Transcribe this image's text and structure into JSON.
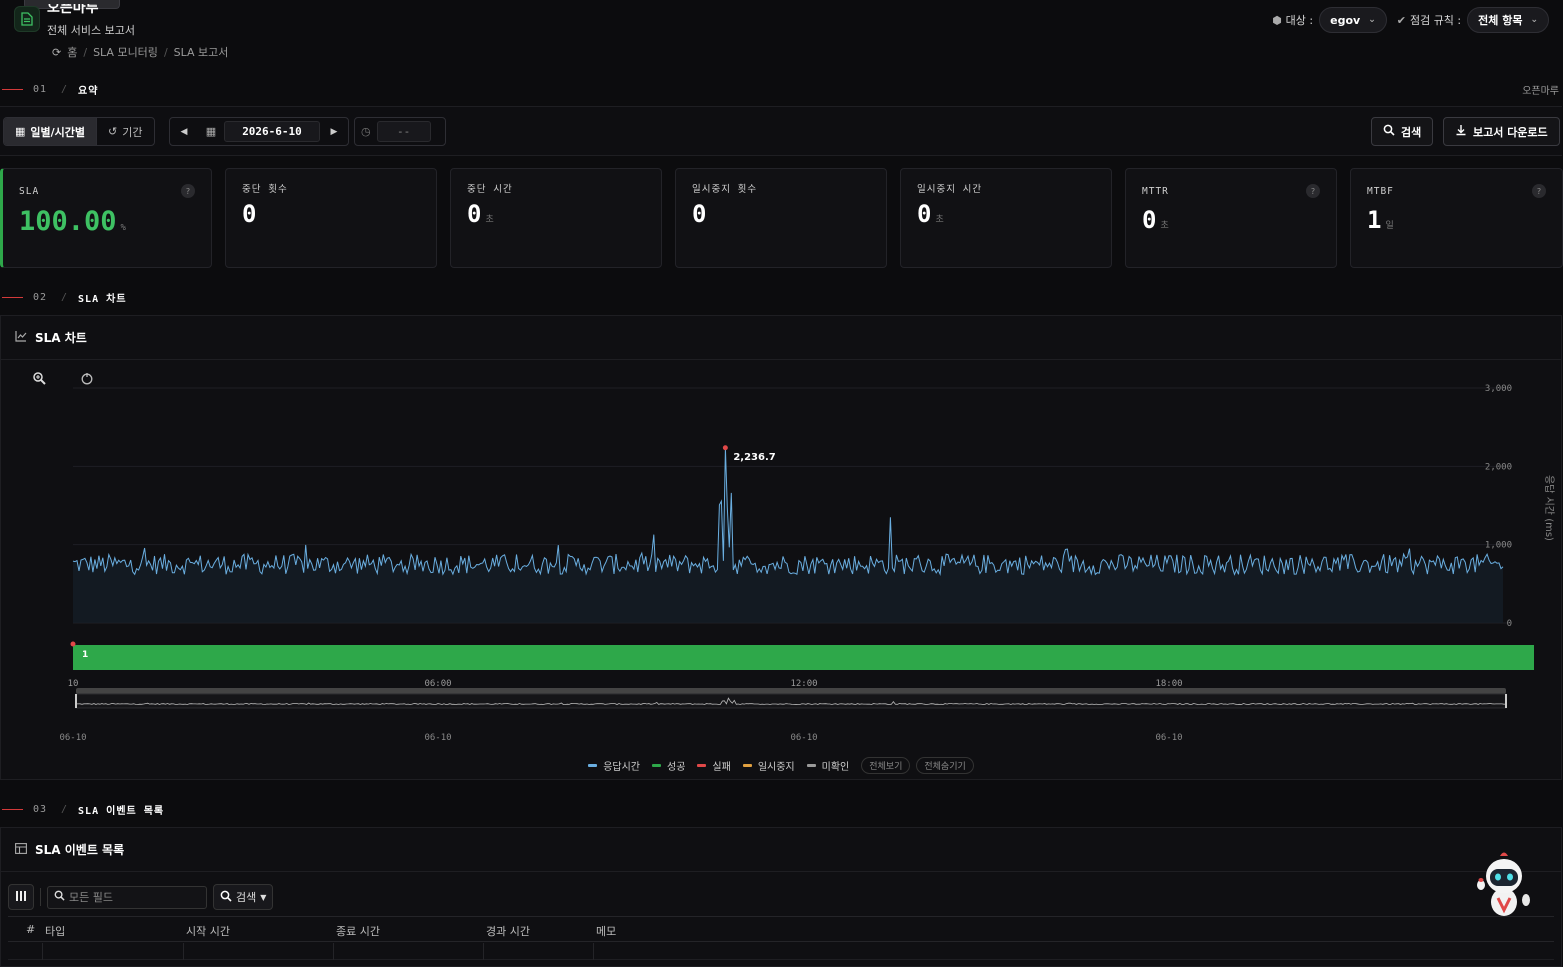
{
  "header": {
    "app_title": "오픈마루",
    "app_subtitle": "전체 서비스 보고서",
    "breadcrumb": [
      "홈",
      "SLA 모니터링",
      "SLA 보고서"
    ],
    "target_label": "대상 :",
    "target_value": "egov",
    "rule_label": "점검 규칙 :",
    "rule_value": "전체 항목"
  },
  "sections": {
    "s1": {
      "num": "01",
      "title": "요약",
      "right": "오픈마루"
    },
    "s2": {
      "num": "02",
      "title": "SLA 차트"
    },
    "s3": {
      "num": "03",
      "title": "SLA 이벤트 목록"
    }
  },
  "toolbar": {
    "mode_daily": "일별/시간별",
    "mode_period": "기간",
    "date": "2026-6-10",
    "time": "--",
    "search_button": "검색",
    "download_button": "보고서 다운로드"
  },
  "cards": [
    {
      "label": "SLA",
      "value": "100.00",
      "unit": "%",
      "help": "?"
    },
    {
      "label": "중단 횟수",
      "value": "0",
      "unit": ""
    },
    {
      "label": "중단 시간",
      "value": "0",
      "unit": "초"
    },
    {
      "label": "일시중지 횟수",
      "value": "0",
      "unit": ""
    },
    {
      "label": "일시중지 시간",
      "value": "0",
      "unit": "초"
    },
    {
      "label": "MTTR",
      "value": "0",
      "unit": "초",
      "help": "?"
    },
    {
      "label": "MTBF",
      "value": "1",
      "unit": "일",
      "help": "?"
    }
  ],
  "chart_panel": {
    "title": "SLA 차트",
    "peak_label": "2,236.7",
    "status_bar_label": "1",
    "legend": [
      "응답시간",
      "성공",
      "실패",
      "일시중지",
      "미확인"
    ],
    "legend_colors": [
      "#6aaee0",
      "#2ea84a",
      "#e04848",
      "#e0a040",
      "#9a9a9a"
    ],
    "show_all": "전체보기",
    "hide_all": "전체숨기기"
  },
  "chart_data": {
    "type": "line",
    "title": "",
    "ylabel": "응답 시간 (ms)",
    "ylim": [
      0,
      3000
    ],
    "y_ticks": [
      "3,000",
      "2,000",
      "1,000",
      "0"
    ],
    "x_ticks": [
      "10",
      "06:00",
      "12:00",
      "18:00"
    ],
    "navigator_ticks": [
      "06-10",
      "06-10",
      "06-10",
      "06-10"
    ],
    "series": [
      {
        "name": "응답시간",
        "baseline": 750,
        "noise": 130,
        "peak": {
          "x": "10:40",
          "y": 2236.7
        }
      }
    ]
  },
  "events_panel": {
    "title": "SLA 이벤트 목록",
    "search_placeholder": "모든 필드",
    "search_select": "검색",
    "columns": [
      "#",
      "타입",
      "시작 시간",
      "종료 시간",
      "경과 시간",
      "메모"
    ]
  }
}
